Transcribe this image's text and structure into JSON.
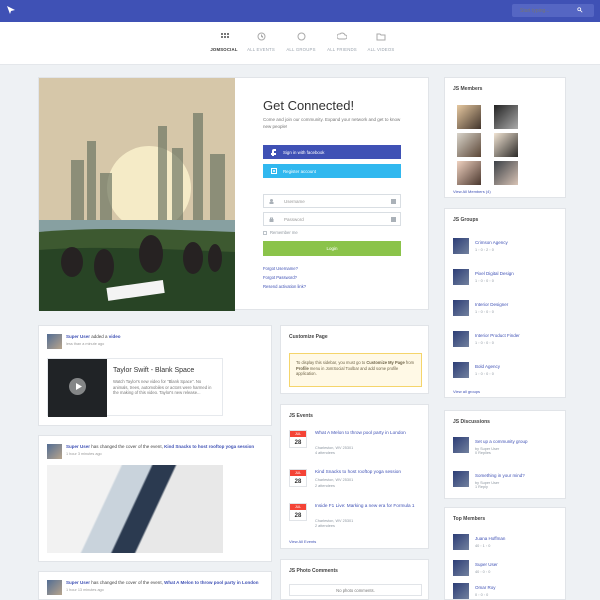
{
  "topbar": {
    "search_placeholder": "Start typing...",
    "accent": "#3f51b5"
  },
  "navigation": [
    {
      "label": "JOMSOCIAL",
      "icon": "grid-icon"
    },
    {
      "label": "ALL EVENTS",
      "icon": "clock-icon"
    },
    {
      "label": "ALL GROUPS",
      "icon": "groups-icon"
    },
    {
      "label": "ALL FRIENDS",
      "icon": "cloud-icon"
    },
    {
      "label": "ALL VIDEOS",
      "icon": "folder-icon"
    }
  ],
  "hero": {
    "title": "Get Connected!",
    "intro": "Come and join our community. Expand your network and get to know new people!",
    "facebook": "Sign in with facebook",
    "register": "Register account",
    "username": "Username",
    "password": "Password",
    "remember": "Remember me",
    "login": "Login",
    "forgot_username": "Forgot Username?",
    "forgot_password": "Forgot Password?",
    "resend": "Resend activation link?"
  },
  "members": {
    "title": "JS Members",
    "view_all": "View All Members (4)"
  },
  "groups": {
    "title": "JS Groups",
    "items": [
      {
        "name": "Crimson Agency",
        "meta": "1 ◦ 0 ◦ 2 ◦ 0"
      },
      {
        "name": "Pixel Digital Design",
        "meta": "1 ◦ 0 ◦ 0 ◦ 0"
      },
      {
        "name": "Interior Designer",
        "meta": "1 ◦ 0 ◦ 0 ◦ 0"
      },
      {
        "name": "Interior Product Finder",
        "meta": "1 ◦ 0 ◦ 0 ◦ 0"
      },
      {
        "name": "Bold Agency",
        "meta": "1 ◦ 0 ◦ 0 ◦ 0"
      }
    ],
    "view_all": "View all groups"
  },
  "discussions": {
    "title": "JS Discussions",
    "items": [
      {
        "name": "Set up a community group",
        "meta": "by Super User\n0 Replies"
      },
      {
        "name": "Something in your mind?",
        "meta": "by Super User\n1 Reply"
      }
    ]
  },
  "top_members": {
    "title": "Top Members",
    "items": [
      {
        "name": "Juana Hoffman",
        "meta": "40 ◦ 1 ◦ 0"
      },
      {
        "name": "Super User",
        "meta": "40 ◦ 0 ◦ 0"
      },
      {
        "name": "Omar Roy",
        "meta": "0 ◦ 0 ◦ 0"
      }
    ]
  },
  "feed": [
    {
      "user": "Super User",
      "action": " added a ",
      "target": "video",
      "time": "less than a minute ago",
      "video_title": "Taylor Swift - Blank Space",
      "video_desc": "Watch Taylor's new video for \"Blank Space\". No animals, trees, automobiles or actors were harmed in the making of this video. Taylor's new release..."
    },
    {
      "user": "Super User",
      "action": " has changed the cover of the event, ",
      "target": "Kind Snacks to host rooftop yoga session",
      "time": "1 hour 3 minutes ago"
    },
    {
      "user": "Super User",
      "action": " has changed the cover of the event, ",
      "target": "What A Melon to throw pool party in London",
      "time": "1 hour 13 minutes ago"
    }
  ],
  "customize": {
    "title": "Customize Page",
    "text_1": "To display this sidebar, you must go to ",
    "text_2": "Customize My Page",
    "text_3": " from ",
    "text_4": "Profile",
    "text_5": " menu in JomSocial Toolbar and add some profile application."
  },
  "events": {
    "title": "JS Events",
    "items": [
      {
        "month": "JUL",
        "day": "28",
        "title": "What A Melon to throw pool party in London",
        "location": "Charleston, WV 25301",
        "attendees": "4 attendees"
      },
      {
        "month": "JUL",
        "day": "28",
        "title": "Kind Snacks to host rooftop yoga session",
        "location": "Charleston, WV 25301",
        "attendees": "2 attendees"
      },
      {
        "month": "JUL",
        "day": "28",
        "title": "Inside F1 Live: Marking a new era for Formula 1",
        "location": "Charleston, WV 25301",
        "attendees": "2 attendees"
      }
    ],
    "view_all": "View All Events"
  },
  "photo_comments": {
    "title": "JS Photo Comments",
    "empty": "No photo comments."
  }
}
